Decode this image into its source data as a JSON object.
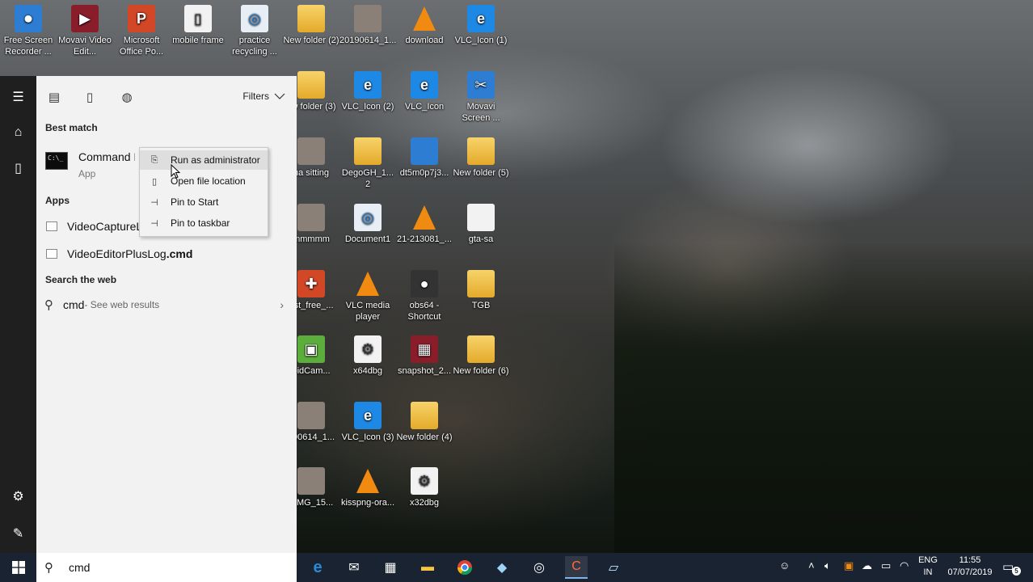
{
  "desktop_icons": [
    {
      "label": "Free Screen Recorder ...",
      "glyph": "⏺",
      "style": "g-app"
    },
    {
      "label": "Movavi Video Edit...",
      "glyph": "▶",
      "style": "g-red"
    },
    {
      "label": "Microsoft Office Po...",
      "glyph": "P",
      "style": "g-orange"
    },
    {
      "label": "mobile frame",
      "glyph": "▯",
      "style": "g-white"
    },
    {
      "label": "practice recycling ...",
      "glyph": "◎",
      "style": "g-circle"
    },
    {
      "label": "New folder (2)",
      "glyph": "",
      "style": "g-folder"
    },
    {
      "label": "20190614_1...",
      "glyph": "",
      "style": "g-photo"
    },
    {
      "label": "download",
      "glyph": "",
      "style": "g-vlc"
    },
    {
      "label": "VLC_Icon (1)",
      "glyph": "e",
      "style": "g-ie"
    },
    {
      "label": "ew folder (3)",
      "glyph": "",
      "style": "g-folder"
    },
    {
      "label": "VLC_Icon (2)",
      "glyph": "e",
      "style": "g-ie"
    },
    {
      "label": "VLC_Icon",
      "glyph": "e",
      "style": "g-ie"
    },
    {
      "label": "Movavi Screen ...",
      "glyph": "✂",
      "style": "g-app"
    },
    {
      "label": "na sitting",
      "glyph": "",
      "style": "g-photo"
    },
    {
      "label": "DegoGH_1... 2",
      "glyph": "",
      "style": "g-folder"
    },
    {
      "label": "dt5m0p7j3...",
      "glyph": "",
      "style": "g-app"
    },
    {
      "label": "New folder (5)",
      "glyph": "",
      "style": "g-folder"
    },
    {
      "label": "mmmmm",
      "glyph": "",
      "style": "g-photo"
    },
    {
      "label": "Document1",
      "glyph": "◎",
      "style": "g-circle"
    },
    {
      "label": "21-213081_...",
      "glyph": "",
      "style": "g-vlc"
    },
    {
      "label": "gta-sa",
      "glyph": "",
      "style": "g-white"
    },
    {
      "label": "ast_free_...",
      "glyph": "✚",
      "style": "g-orange"
    },
    {
      "label": "VLC media player",
      "glyph": "",
      "style": "g-vlc"
    },
    {
      "label": "obs64 - Shortcut",
      "glyph": "●",
      "style": "g-dark"
    },
    {
      "label": "TGB",
      "glyph": "",
      "style": "g-folder"
    },
    {
      "label": "oidCam...",
      "glyph": "▣",
      "style": "g-green"
    },
    {
      "label": "x64dbg",
      "glyph": "⚙",
      "style": "g-white"
    },
    {
      "label": "snapshot_2...",
      "glyph": "▦",
      "style": "g-red"
    },
    {
      "label": "New folder (6)",
      "glyph": "",
      "style": "g-folder"
    },
    {
      "label": "190614_1...",
      "glyph": "",
      "style": "g-photo"
    },
    {
      "label": "VLC_Icon (3)",
      "glyph": "e",
      "style": "g-ie"
    },
    {
      "label": "New folder (4)",
      "glyph": "",
      "style": "g-folder"
    },
    {
      "label": "_IMG_15...",
      "glyph": "",
      "style": "g-photo"
    },
    {
      "label": "kisspng-ora...",
      "glyph": "",
      "style": "g-vlc"
    },
    {
      "label": "x32dbg",
      "glyph": "⚙",
      "style": "g-white"
    }
  ],
  "search_panel": {
    "filters_label": "Filters",
    "best_match_heading": "Best match",
    "best_match": {
      "title": "Command Prompt",
      "subtitle": "App"
    },
    "apps_heading": "Apps",
    "apps": [
      {
        "name": "VideoCaptureLog.cmd"
      },
      {
        "name_plain": "VideoEditorPlusLog",
        "name_bold": ".cmd"
      }
    ],
    "web_heading": "Search the web",
    "web_query": "cmd",
    "web_hint": " - See web results",
    "query": "cmd"
  },
  "context_menu": {
    "items": [
      "Run as administrator",
      "Open file location",
      "Pin to Start",
      "Pin to taskbar"
    ]
  },
  "taskbar": {
    "language_top": "ENG",
    "language_bottom": "IN",
    "time": "11:55",
    "date": "07/07/2019",
    "notification_count": "5"
  }
}
